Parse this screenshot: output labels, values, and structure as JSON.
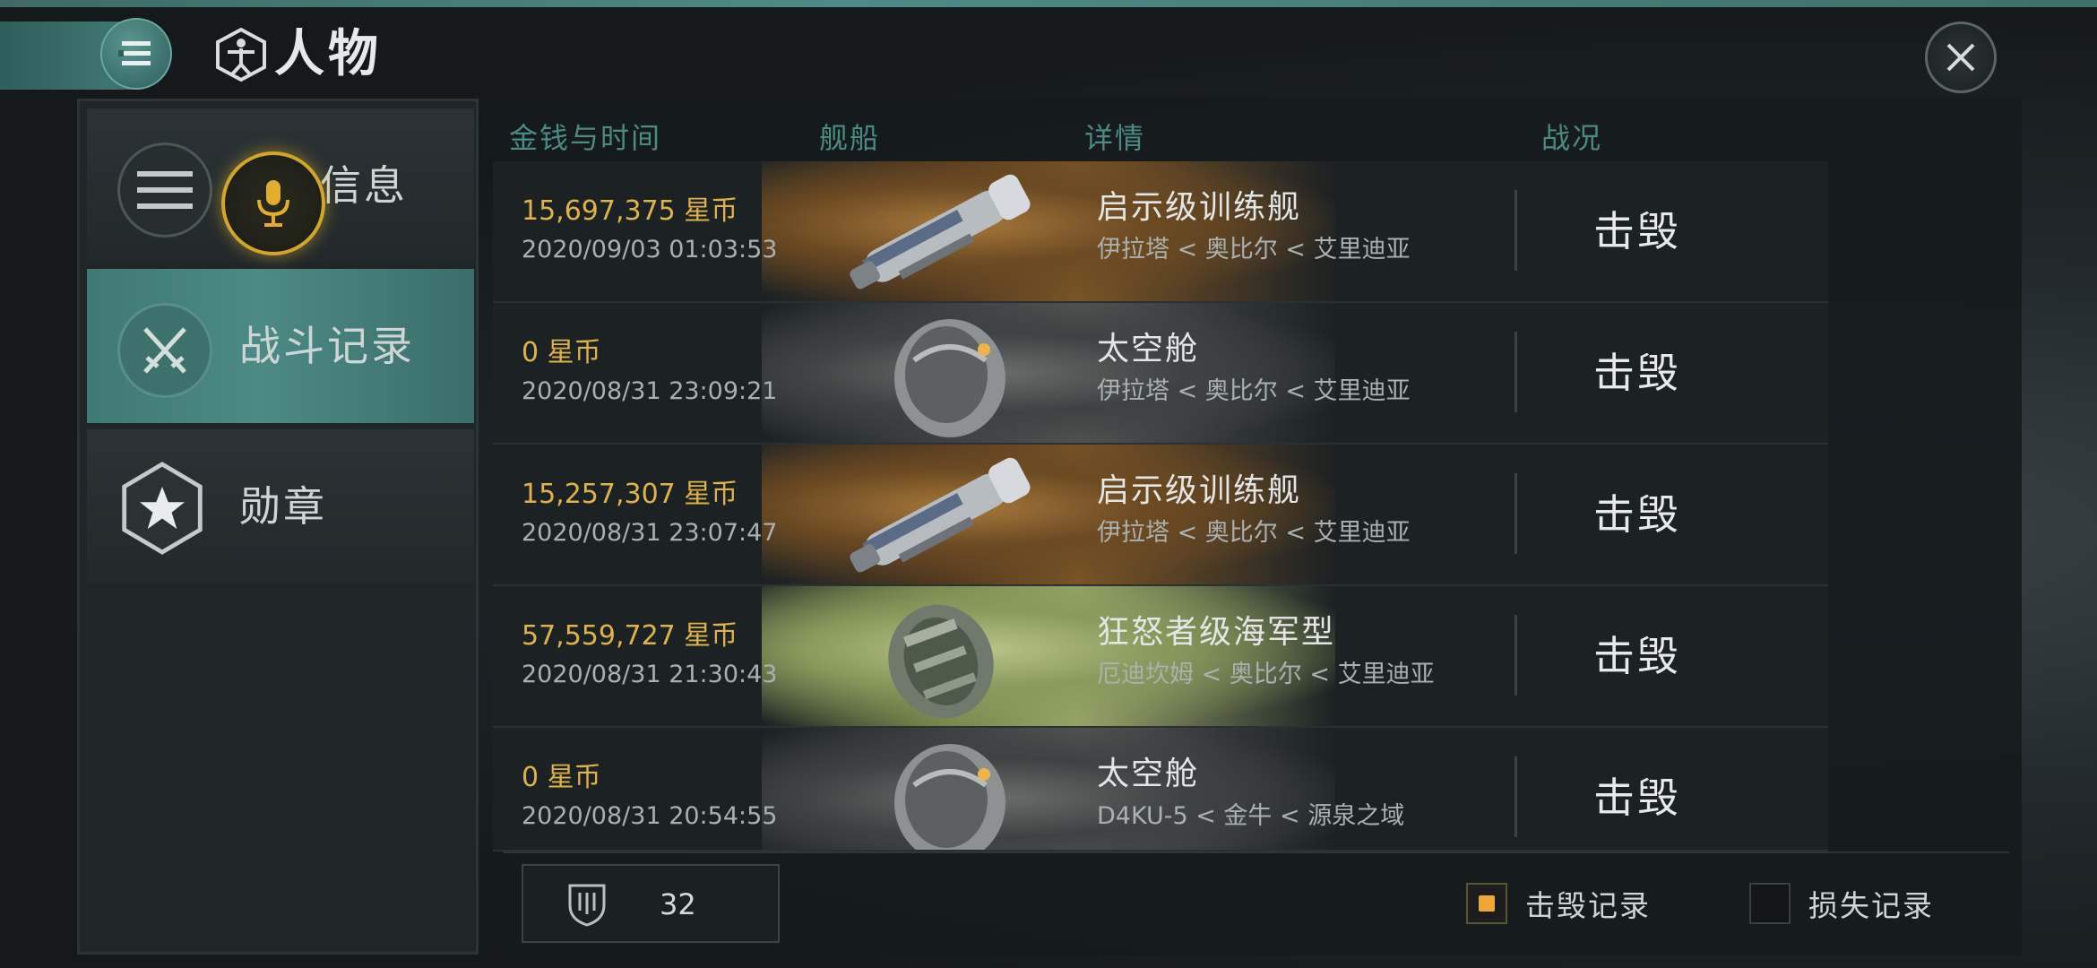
{
  "header": {
    "title": "人物"
  },
  "sidebar": {
    "items": [
      {
        "label": "信息",
        "icon": "list-icon"
      },
      {
        "label": "战斗记录",
        "icon": "crossed-swords-icon"
      },
      {
        "label": "勋章",
        "icon": "star-badge-icon"
      }
    ],
    "voice_button": {
      "icon": "microphone-icon"
    }
  },
  "table": {
    "headers": {
      "money_time": "金钱与时间",
      "ship": "舰船",
      "detail": "详情",
      "status": "战况"
    },
    "rows": [
      {
        "amount": "15,697,375  星币",
        "date": "2020/09/03  01:03:53",
        "ship_name": "启示级训练舰",
        "location": "伊拉塔 < 奥比尔 < 艾里迪亚",
        "status": "击毁",
        "bg": "gold"
      },
      {
        "amount": "0  星币",
        "date": "2020/08/31  23:09:21",
        "ship_name": "太空舱",
        "location": "伊拉塔 < 奥比尔 < 艾里迪亚",
        "status": "击毁",
        "bg": "gray"
      },
      {
        "amount": "15,257,307  星币",
        "date": "2020/08/31  23:07:47",
        "ship_name": "启示级训练舰",
        "location": "伊拉塔 < 奥比尔 < 艾里迪亚",
        "status": "击毁",
        "bg": "gold"
      },
      {
        "amount": "57,559,727  星币",
        "date": "2020/08/31  21:30:43",
        "ship_name": "狂怒者级海军型",
        "location": "厄迪坎姆 < 奥比尔 < 艾里迪亚",
        "status": "击毁",
        "bg": "green"
      },
      {
        "amount": "0  星币",
        "date": "2020/08/31  20:54:55",
        "ship_name": "太空舱",
        "location": "D4KU-5 < 金牛 < 源泉之域",
        "status": "击毁",
        "bg": "gray"
      }
    ]
  },
  "footer": {
    "count": "32",
    "kill_record_label": "击毁记录",
    "loss_record_label": "损失记录"
  },
  "colors": {
    "accent": "#4b8b84",
    "currency": "#e0b24a",
    "checkbox_on": "#f2a63a"
  }
}
